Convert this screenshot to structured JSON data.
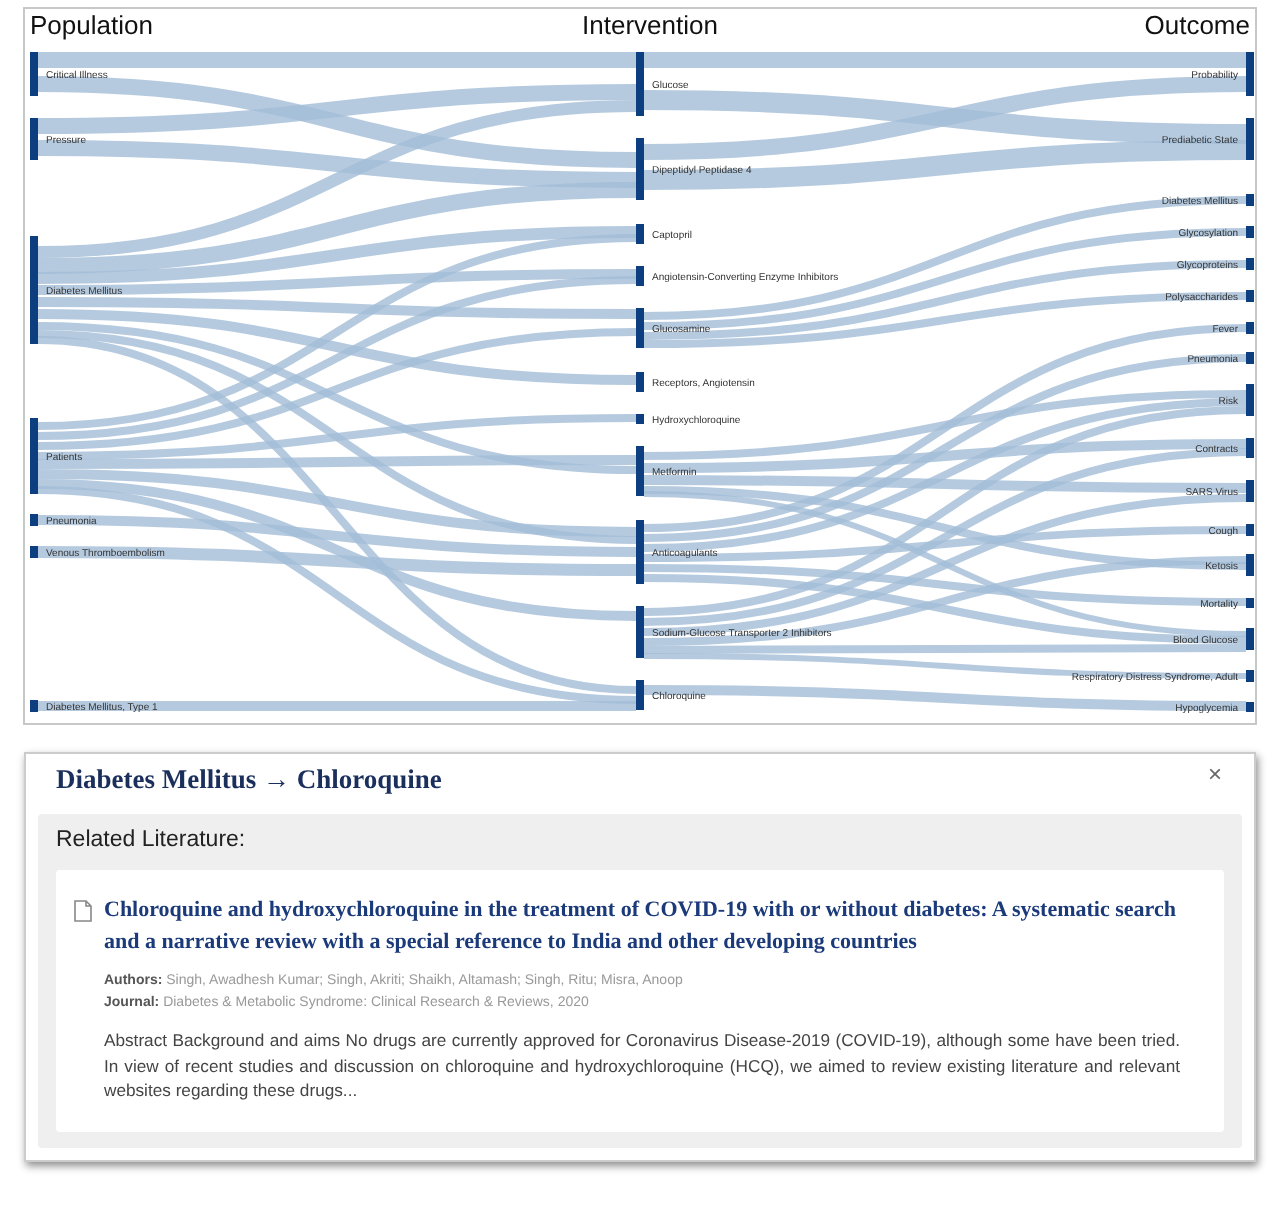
{
  "sankey": {
    "columns": [
      {
        "title": "Population",
        "nodes": [
          {
            "label": "Critical Illness"
          },
          {
            "label": "Pressure"
          },
          {
            "label": "Diabetes Mellitus"
          },
          {
            "label": "Patients"
          },
          {
            "label": "Pneumonia"
          },
          {
            "label": "Venous Thromboembolism"
          },
          {
            "label": "Diabetes Mellitus, Type 1"
          }
        ]
      },
      {
        "title": "Intervention",
        "nodes": [
          {
            "label": "Glucose"
          },
          {
            "label": "Dipeptidyl Peptidase 4"
          },
          {
            "label": "Captopril"
          },
          {
            "label": "Angiotensin-Converting Enzyme Inhibitors"
          },
          {
            "label": "Glucosamine"
          },
          {
            "label": "Receptors, Angiotensin"
          },
          {
            "label": "Hydroxychloroquine"
          },
          {
            "label": "Metformin"
          },
          {
            "label": "Anticoagulants"
          },
          {
            "label": "Sodium-Glucose Transporter 2 Inhibitors"
          },
          {
            "label": "Chloroquine"
          }
        ]
      },
      {
        "title": "Outcome",
        "nodes": [
          {
            "label": "Probability"
          },
          {
            "label": "Prediabetic State"
          },
          {
            "label": "Diabetes Mellitus"
          },
          {
            "label": "Glycosylation"
          },
          {
            "label": "Glycoproteins"
          },
          {
            "label": "Polysaccharides"
          },
          {
            "label": "Fever"
          },
          {
            "label": "Pneumonia"
          },
          {
            "label": "Risk"
          },
          {
            "label": "Contracts"
          },
          {
            "label": "SARS Virus"
          },
          {
            "label": "Cough"
          },
          {
            "label": "Ketosis"
          },
          {
            "label": "Mortality"
          },
          {
            "label": "Blood Glucose"
          },
          {
            "label": "Respiratory Distress Syndrome, Adult"
          },
          {
            "label": "Hypoglycemia"
          }
        ]
      }
    ]
  },
  "panel": {
    "title": "Diabetes Mellitus → Chloroquine",
    "close": "×",
    "section_title": "Related Literature:",
    "articles": [
      {
        "title": "Chloroquine and hydroxychloroquine in the treatment of COVID-19 with or without diabetes: A systematic search and a narrative review with a special reference to India and other developing countries",
        "authors_label": "Authors:",
        "authors": "Singh, Awadhesh Kumar; Singh, Akriti; Shaikh, Altamash; Singh, Ritu; Misra, Anoop",
        "journal_label": "Journal:",
        "journal": "Diabetes & Metabolic Syndrome: Clinical Research & Reviews, 2020",
        "abstract": "Abstract Background and aims No drugs are currently approved for Coronavirus Disease-2019 (COVID-19), although some have been tried. In view of recent studies and discussion on chloroquine and hydroxychloroquine (HCQ), we aimed to review existing literature and relevant websites regarding these drugs..."
      }
    ]
  }
}
